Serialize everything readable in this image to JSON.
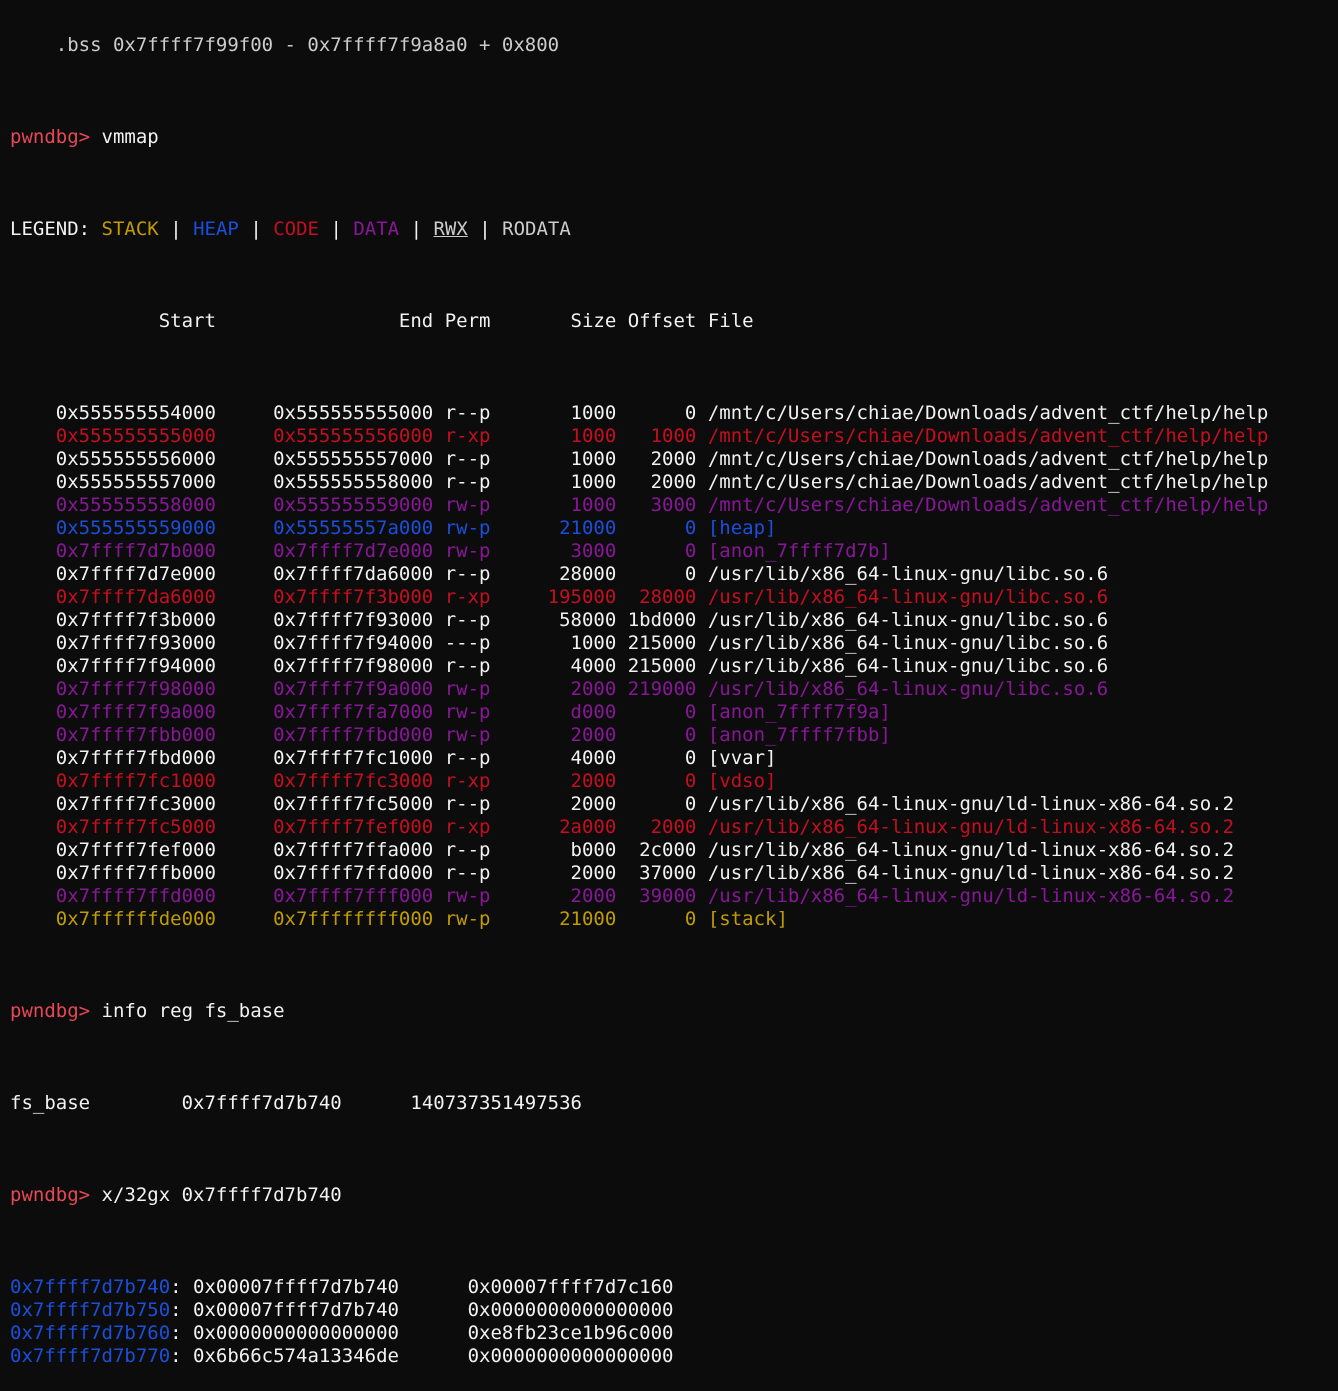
{
  "colors": {
    "background": "#0c0c0c",
    "prompt": "#e74856",
    "text": "#cccccc",
    "stack": "#c19c00",
    "heap": "#1a4fdb",
    "code": "#c50f1f",
    "data": "#881798"
  },
  "top_partial": "    .bss 0x7ffff7f99f00 - 0x7ffff7f9a8a0 + 0x800",
  "prompt": "pwndbg>",
  "commands": {
    "vmmap": "vmmap",
    "info_reg": "info reg fs_base",
    "examine": "x/32gx 0x7ffff7d7b740"
  },
  "legend": {
    "label": "LEGEND:",
    "stack": "STACK",
    "heap": "HEAP",
    "code": "CODE",
    "data": "DATA",
    "rwx": "RWX",
    "rodata": "RODATA",
    "sep": "|"
  },
  "vmmap_header": {
    "start": "Start",
    "end": "End",
    "perm": "Perm",
    "size": "Size",
    "offset": "Offset",
    "file": "File"
  },
  "vmmap_rows": [
    {
      "start": "0x555555554000",
      "end": "0x555555555000",
      "perm": "r--p",
      "size": "1000",
      "offset": "0",
      "file": "/mnt/c/Users/chiae/Downloads/advent_ctf/help/help",
      "kind": "white"
    },
    {
      "start": "0x555555555000",
      "end": "0x555555556000",
      "perm": "r-xp",
      "size": "1000",
      "offset": "1000",
      "file": "/mnt/c/Users/chiae/Downloads/advent_ctf/help/help",
      "kind": "code"
    },
    {
      "start": "0x555555556000",
      "end": "0x555555557000",
      "perm": "r--p",
      "size": "1000",
      "offset": "2000",
      "file": "/mnt/c/Users/chiae/Downloads/advent_ctf/help/help",
      "kind": "white"
    },
    {
      "start": "0x555555557000",
      "end": "0x555555558000",
      "perm": "r--p",
      "size": "1000",
      "offset": "2000",
      "file": "/mnt/c/Users/chiae/Downloads/advent_ctf/help/help",
      "kind": "white"
    },
    {
      "start": "0x555555558000",
      "end": "0x555555559000",
      "perm": "rw-p",
      "size": "1000",
      "offset": "3000",
      "file": "/mnt/c/Users/chiae/Downloads/advent_ctf/help/help",
      "kind": "data"
    },
    {
      "start": "0x555555559000",
      "end": "0x55555557a000",
      "perm": "rw-p",
      "size": "21000",
      "offset": "0",
      "file": "[heap]",
      "kind": "heap"
    },
    {
      "start": "0x7ffff7d7b000",
      "end": "0x7ffff7d7e000",
      "perm": "rw-p",
      "size": "3000",
      "offset": "0",
      "file": "[anon_7ffff7d7b]",
      "kind": "data"
    },
    {
      "start": "0x7ffff7d7e000",
      "end": "0x7ffff7da6000",
      "perm": "r--p",
      "size": "28000",
      "offset": "0",
      "file": "/usr/lib/x86_64-linux-gnu/libc.so.6",
      "kind": "white"
    },
    {
      "start": "0x7ffff7da6000",
      "end": "0x7ffff7f3b000",
      "perm": "r-xp",
      "size": "195000",
      "offset": "28000",
      "file": "/usr/lib/x86_64-linux-gnu/libc.so.6",
      "kind": "code"
    },
    {
      "start": "0x7ffff7f3b000",
      "end": "0x7ffff7f93000",
      "perm": "r--p",
      "size": "58000",
      "offset": "1bd000",
      "file": "/usr/lib/x86_64-linux-gnu/libc.so.6",
      "kind": "white"
    },
    {
      "start": "0x7ffff7f93000",
      "end": "0x7ffff7f94000",
      "perm": "---p",
      "size": "1000",
      "offset": "215000",
      "file": "/usr/lib/x86_64-linux-gnu/libc.so.6",
      "kind": "white"
    },
    {
      "start": "0x7ffff7f94000",
      "end": "0x7ffff7f98000",
      "perm": "r--p",
      "size": "4000",
      "offset": "215000",
      "file": "/usr/lib/x86_64-linux-gnu/libc.so.6",
      "kind": "white"
    },
    {
      "start": "0x7ffff7f98000",
      "end": "0x7ffff7f9a000",
      "perm": "rw-p",
      "size": "2000",
      "offset": "219000",
      "file": "/usr/lib/x86_64-linux-gnu/libc.so.6",
      "kind": "data"
    },
    {
      "start": "0x7ffff7f9a000",
      "end": "0x7ffff7fa7000",
      "perm": "rw-p",
      "size": "d000",
      "offset": "0",
      "file": "[anon_7ffff7f9a]",
      "kind": "data"
    },
    {
      "start": "0x7ffff7fbb000",
      "end": "0x7ffff7fbd000",
      "perm": "rw-p",
      "size": "2000",
      "offset": "0",
      "file": "[anon_7ffff7fbb]",
      "kind": "data"
    },
    {
      "start": "0x7ffff7fbd000",
      "end": "0x7ffff7fc1000",
      "perm": "r--p",
      "size": "4000",
      "offset": "0",
      "file": "[vvar]",
      "kind": "white"
    },
    {
      "start": "0x7ffff7fc1000",
      "end": "0x7ffff7fc3000",
      "perm": "r-xp",
      "size": "2000",
      "offset": "0",
      "file": "[vdso]",
      "kind": "code"
    },
    {
      "start": "0x7ffff7fc3000",
      "end": "0x7ffff7fc5000",
      "perm": "r--p",
      "size": "2000",
      "offset": "0",
      "file": "/usr/lib/x86_64-linux-gnu/ld-linux-x86-64.so.2",
      "kind": "white"
    },
    {
      "start": "0x7ffff7fc5000",
      "end": "0x7ffff7fef000",
      "perm": "r-xp",
      "size": "2a000",
      "offset": "2000",
      "file": "/usr/lib/x86_64-linux-gnu/ld-linux-x86-64.so.2",
      "kind": "code"
    },
    {
      "start": "0x7ffff7fef000",
      "end": "0x7ffff7ffa000",
      "perm": "r--p",
      "size": "b000",
      "offset": "2c000",
      "file": "/usr/lib/x86_64-linux-gnu/ld-linux-x86-64.so.2",
      "kind": "white"
    },
    {
      "start": "0x7ffff7ffb000",
      "end": "0x7ffff7ffd000",
      "perm": "r--p",
      "size": "2000",
      "offset": "37000",
      "file": "/usr/lib/x86_64-linux-gnu/ld-linux-x86-64.so.2",
      "kind": "white"
    },
    {
      "start": "0x7ffff7ffd000",
      "end": "0x7ffff7fff000",
      "perm": "rw-p",
      "size": "2000",
      "offset": "39000",
      "file": "/usr/lib/x86_64-linux-gnu/ld-linux-x86-64.so.2",
      "kind": "data"
    },
    {
      "start": "0x7ffffffde000",
      "end": "0x7ffffffff000",
      "perm": "rw-p",
      "size": "21000",
      "offset": "0",
      "file": "[stack]",
      "kind": "stack"
    }
  ],
  "fs_base": {
    "name": "fs_base",
    "hex": "0x7ffff7d7b740",
    "dec": "140737351497536"
  },
  "memory_rows": [
    {
      "addr": "0x7ffff7d7b740",
      "v1": "0x00007ffff7d7b740",
      "v2": "0x00007ffff7d7c160"
    },
    {
      "addr": "0x7ffff7d7b750",
      "v1": "0x00007ffff7d7b740",
      "v2": "0x0000000000000000"
    },
    {
      "addr": "0x7ffff7d7b760",
      "v1": "0x0000000000000000",
      "v2": "0xe8fb23ce1b96c000"
    },
    {
      "addr": "0x7ffff7d7b770",
      "v1": "0x6b66c574a13346de",
      "v2": "0x0000000000000000"
    }
  ]
}
